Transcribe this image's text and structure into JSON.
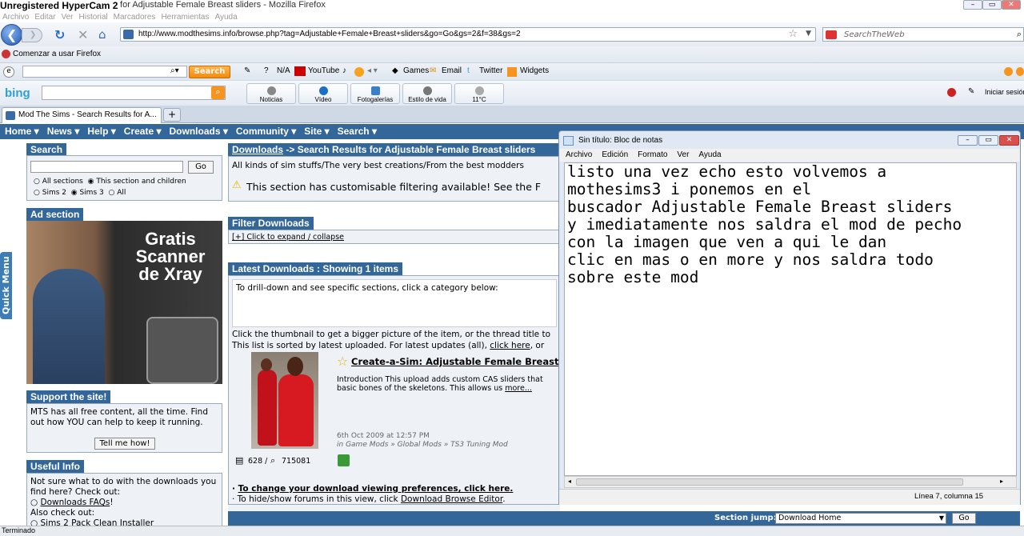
{
  "recorder": "Unregistered HyperCam 2",
  "window_title": "lts for Adjustable Female Breast sliders - Mozilla Firefox",
  "menu": [
    "Archivo",
    "Editar",
    "Ver",
    "Historial",
    "Marcadores",
    "Herramientas",
    "Ayuda"
  ],
  "url": "http://www.modthesims.info/browse.php?tag=Adjustable+Female+Breast+sliders&go=Go&gs=2&f=38&gs=2",
  "search_placeholder": "SearchTheWeb",
  "bookmark": "Comenzar a usar Firefox",
  "toolbar": {
    "search_label": "Search",
    "na": "N/A",
    "youtube": "YouTube",
    "games": "Games",
    "email": "Email",
    "twitter": "Twitter",
    "widgets": "Widgets",
    "right": "Iniciar sesión"
  },
  "bing": {
    "logo": "bing",
    "buttons": [
      "Noticias",
      "Vídeo",
      "Fotogalerías",
      "Estilo de vida",
      "11°C"
    ]
  },
  "tab_title": "Mod The Sims - Search Results for A...",
  "sitenav": [
    "Home ▾",
    "News ▾",
    "Help ▾",
    "Create ▾",
    "Downloads ▾",
    "Community ▾",
    "Site ▾",
    "Search ▾"
  ],
  "quick_menu": "Quick Menu",
  "search_box": {
    "title": "Search",
    "go": "Go",
    "opt1": "All sections",
    "opt2": "This section and children",
    "opt3": "Sims 2",
    "opt4": "Sims 3",
    "opt5": "All"
  },
  "ad": {
    "title": "Ad section",
    "line1": "Gratis",
    "line2": "Scanner",
    "line3": "de Xray"
  },
  "support": {
    "title": "Support the site!",
    "text": "MTS has all free content, all the time. Find out how YOU can help to keep it running.",
    "button": "Tell me how!"
  },
  "useful": {
    "title": "Useful Info",
    "text1": "Not sure what to do with the downloads you find here? Check out:",
    "link1": "Downloads FAQs",
    "bang": "!",
    "text2": "Also check out:",
    "link2": "Sims 2 Pack Clean Installer"
  },
  "main": {
    "heading_link": "Downloads",
    "heading_rest": " -> Search Results for Adjustable Female Breast sliders",
    "tagline": "All kinds of sim stuffs/The very best creations/From the best modders",
    "filter_notice": "This section has customisable filtering available! See the F",
    "filter_title": "Filter Downloads",
    "filter_link": "[+] Click to expand / collapse",
    "latest_title": "Latest Downloads : Showing 1 items",
    "drill": "To drill-down and see specific sections, click a category below:",
    "thumb_text": "Click the thumbnail to get a bigger picture of the item, or the thread title to",
    "sorted_text": "This list is sorted by latest uploaded. For latest updates (all),",
    "click_here": "click here",
    "or_text": ", or",
    "item_title": "Create-a-Sim: Adjustable Female Breast slic",
    "item_intro": "Introduction This upload adds custom CAS sliders that basic bones of the skeletons. This allows us",
    "more": "more...",
    "date": "6th Oct 2009 at 12:57 PM",
    "category": "in Game Mods » Global Mods » TS3 Tuning Mod",
    "stats": "628 /",
    "views": "715081",
    "pref_link": "To change your download viewing preferences, click here.",
    "hide_text": "· To hide/show forums in this view, click ",
    "hide_link": "Download Browse Editor",
    "section_jump": "Section jump:",
    "section_value": "Download Home",
    "section_go": "Go"
  },
  "notepad": {
    "title": "Sin título: Bloc de notas",
    "menu": [
      "Archivo",
      "Edición",
      "Formato",
      "Ver",
      "Ayuda"
    ],
    "text": "listo una vez echo esto volvemos a\nmothesims3 i ponemos en el\nbuscador Adjustable Female Breast sliders\ny imediatamente nos saldra el mod de pecho\ncon la imagen que ven a qui le dan\nclic en mas o en more y nos saldra todo\nsobre este mod",
    "status": "Línea 7, columna 15"
  },
  "status": "Terminado",
  "colors": {
    "nav": "#336699",
    "accent": "#f7941d"
  }
}
